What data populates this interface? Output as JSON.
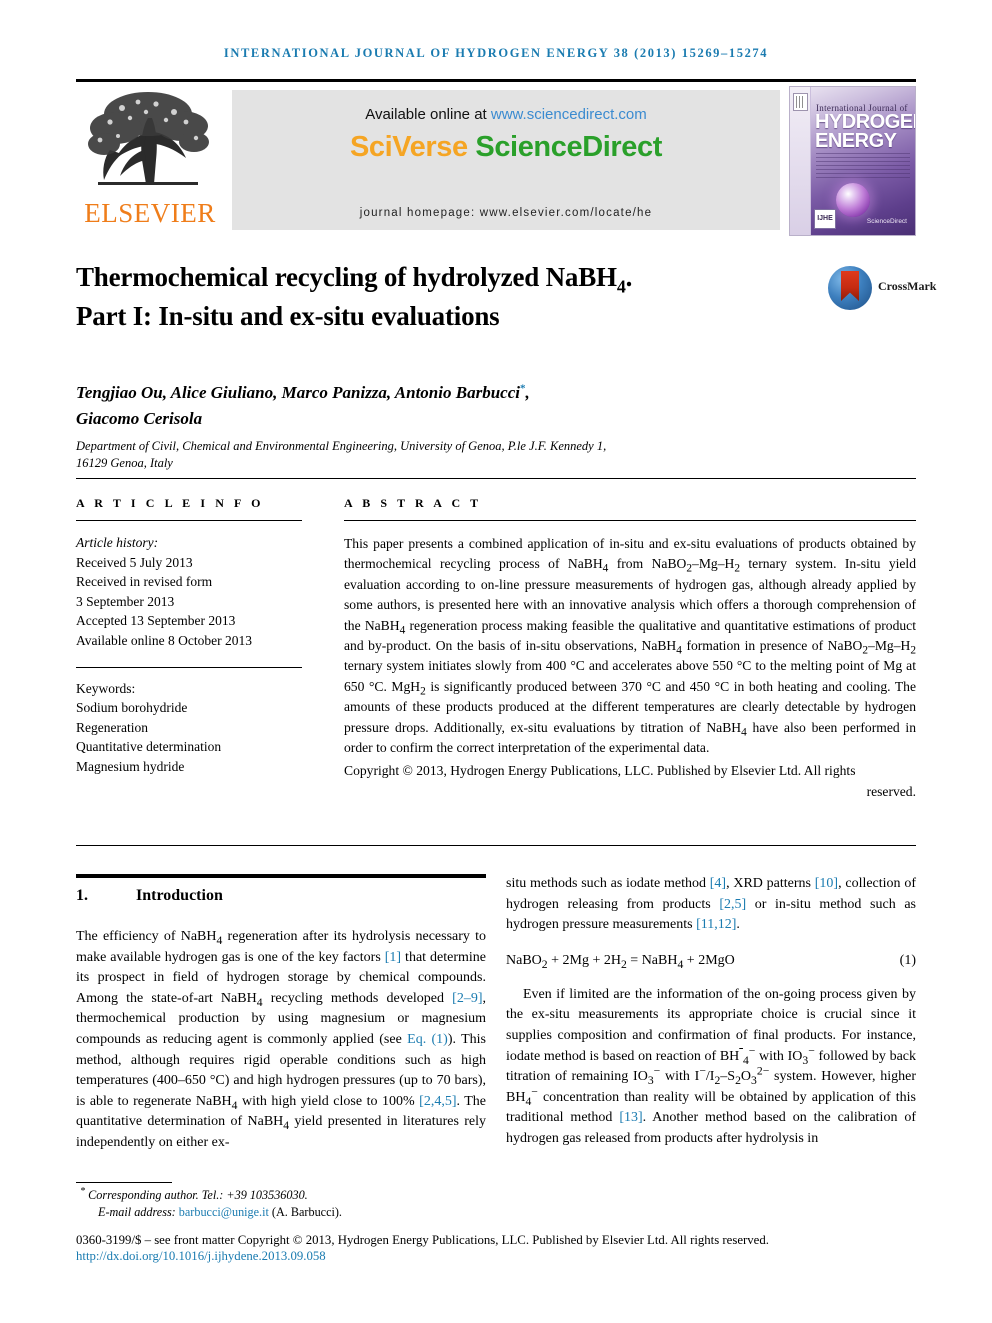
{
  "running_head": "INTERNATIONAL JOURNAL OF HYDROGEN ENERGY 38 (2013) 15269–15274",
  "masthead": {
    "publisher_name": "ELSEVIER",
    "available_prefix": "Available online at ",
    "available_url": "www.sciencedirect.com",
    "sciverse_brand_sci": "SciVerse",
    "sciverse_brand_sd": " ScienceDirect",
    "journal_homepage": "journal homepage: www.elsevier.com/locate/he",
    "cover": {
      "line_small": "International Journal of",
      "line_big_1": "HYDROGEN",
      "line_big_2": "ENERGY",
      "badge": "IJHE",
      "sd_mark": "ScienceDirect"
    }
  },
  "crossmark": {
    "label": "CrossMark"
  },
  "article": {
    "title_line_1": "Thermochemical recycling of hydrolyzed NaBH",
    "title_sub_1": "4",
    "title_line_1_end": ".",
    "title_line_2": "Part I: In-situ and ex-situ evaluations",
    "authors_line_1": "Tengjiao Ou, Alice Giuliano, Marco Panizza, Antonio Barbucci",
    "authors_star": "*",
    "authors_line_1_end": ",",
    "authors_line_2": "Giacomo Cerisola",
    "affiliation_line_1": "Department of Civil, Chemical and Environmental Engineering, University of Genoa, P.le J.F. Kennedy 1,",
    "affiliation_line_2": "16129 Genoa, Italy"
  },
  "article_info": {
    "heading": "A R T I C L E   I N F O",
    "history_label": "Article history:",
    "history": [
      "Received 5 July 2013",
      "Received in revised form",
      "3 September 2013",
      "Accepted 13 September 2013",
      "Available online 8 October 2013"
    ],
    "keywords_label": "Keywords:",
    "keywords": [
      "Sodium borohydride",
      "Regeneration",
      "Quantitative determination",
      "Magnesium hydride"
    ]
  },
  "abstract": {
    "heading": "A B S T R A C T",
    "paragraph_html": "This paper presents a combined application of in-situ and ex-situ evaluations of products obtained by thermochemical recycling process of NaBH<sub>4</sub> from NaBO<sub>2</sub>–Mg–H<sub>2</sub> ternary system. In-situ yield evaluation according to on-line pressure measurements of hydrogen gas, although already applied by some authors, is presented here with an innovative analysis which offers a thorough comprehension of the NaBH<sub>4</sub> regeneration process making feasible the qualitative and quantitative estimations of product and by-product. On the basis of in-situ observations, NaBH<sub>4</sub> formation in presence of NaBO<sub>2</sub>–Mg–H<sub>2</sub> ternary system initiates slowly from 400 °C and accelerates above 550 °C to the melting point of Mg at 650 °C. MgH<sub>2</sub> is significantly produced between 370 °C and 450 °C in both heating and cooling. The amounts of these products produced at the different temperatures are clearly detectable by hydrogen pressure drops. Additionally, ex-situ evaluations by titration of NaBH<sub>4</sub> have also been performed in order to confirm the correct interpretation of the experimental data.",
    "copyright_html": "Copyright © 2013, Hydrogen Energy Publications, LLC. Published by Elsevier Ltd. All rights <span class=\"lastline\">reserved.</span>"
  },
  "body": {
    "section_number": "1.",
    "section_title": "Introduction",
    "left_paragraph_html": "The efficiency of NaBH<sub>4</sub> regeneration after its hydrolysis necessary to make available hydrogen gas is one of the key factors <span class=\"ref\">[1]</span> that determine its prospect in field of hydrogen storage by chemical compounds. Among the state-of-art NaBH<sub>4</sub> recycling methods developed <span class=\"ref\">[2–9]</span>, thermochemical production by using magnesium or magnesium compounds as reducing agent is commonly applied (see <span class=\"ref\">Eq. (1)</span>). This method, although requires rigid operable conditions such as high temperatures (400–650 °C) and high hydrogen pressures (up to 70 bars), is able to regenerate NaBH<sub>4</sub> with high yield close to 100% <span class=\"ref\">[2,4,5]</span>. The quantitative determination of NaBH<sub>4</sub> yield presented in literatures rely independently on either ex-",
    "right_paragraph_1_html": "situ methods such as iodate method <span class=\"ref\">[4]</span>, XRD patterns <span class=\"ref\">[10]</span>, collection of hydrogen releasing from products <span class=\"ref\">[2,5]</span> or in-situ method such as hydrogen pressure measurements <span class=\"ref\">[11,12]</span>.",
    "equation_html": "NaBO<sub>2</sub> + 2Mg + 2H<sub>2</sub> = NaBH<sub>4</sub> + 2MgO",
    "equation_number": "(1)",
    "right_paragraph_2_html": "Even if limited are the information of the on-going process given by the ex-situ measurements its appropriate choice is crucial since it supplies composition and confirmation of final products. For instance, iodate method is based on reaction of BH<span class=\"ovl\">&nbsp;</span><sub>4</sub><sup>−</sup> with IO<sub>3</sub><sup>−</sup> followed by back titration of remaining IO<sub>3</sub><sup>−</sup> with I<sup>−</sup>/I<sub>2</sub>–S<sub>2</sub>O<sub>3</sub><sup>2−</sup> system. However, higher BH<sub>4</sub><sup>−</sup> concentration than reality will be obtained by application of this traditional method <span class=\"ref\">[13]</span>. Another method based on the calibration of hydrogen gas released from products after hydrolysis in"
  },
  "footer": {
    "corresponding_star": "*",
    "corresponding_text": "Corresponding author. Tel.: +39 103536030.",
    "email_label": "E-mail address: ",
    "email_value": "barbucci@unige.it",
    "email_suffix": " (A. Barbucci).",
    "issn_line": "0360-3199/$ – see front matter Copyright © 2013, Hydrogen Energy Publications, LLC. Published by Elsevier Ltd. All rights reserved.",
    "doi": "http://dx.doi.org/10.1016/j.ijhydene.2013.09.058"
  },
  "colors": {
    "journal_blue": "#1a7bb0",
    "elsevier_orange": "#ef7d1a",
    "sciencedirect_green": "#2aa02a",
    "sciverse_amber": "#f5a524"
  }
}
